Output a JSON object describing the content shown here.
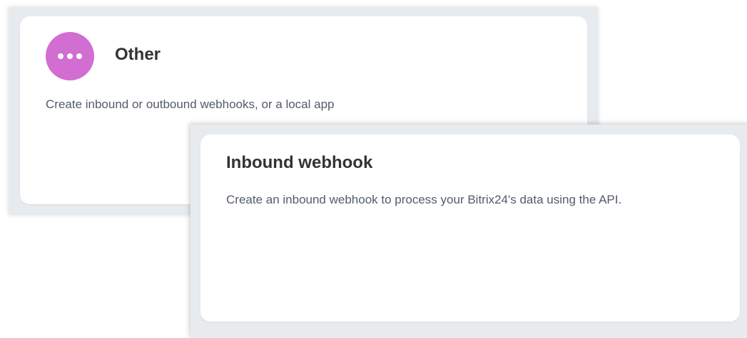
{
  "other_card": {
    "title": "Other",
    "description": "Create inbound or outbound webhooks, or a local app",
    "icon": "more-dots-icon",
    "icon_color": "#d26dd2"
  },
  "inbound_webhook_card": {
    "title": "Inbound webhook",
    "description": "Create an inbound webhook to process your Bitrix24's data using the API."
  }
}
